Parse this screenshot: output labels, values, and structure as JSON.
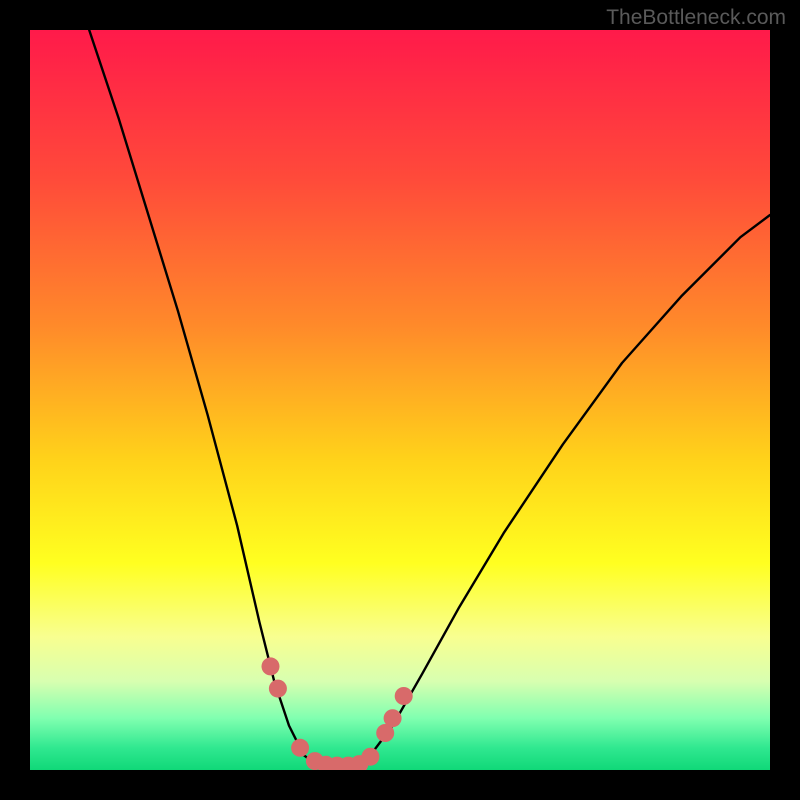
{
  "watermark": "TheBottleneck.com",
  "chart_data": {
    "type": "line",
    "title": "",
    "xlabel": "",
    "ylabel": "",
    "x_range": [
      0,
      100
    ],
    "y_range": [
      0,
      100
    ],
    "curve_left": [
      {
        "x": 8,
        "y": 100
      },
      {
        "x": 12,
        "y": 88
      },
      {
        "x": 16,
        "y": 75
      },
      {
        "x": 20,
        "y": 62
      },
      {
        "x": 24,
        "y": 48
      },
      {
        "x": 28,
        "y": 33
      },
      {
        "x": 31,
        "y": 20
      },
      {
        "x": 33,
        "y": 12
      },
      {
        "x": 35,
        "y": 6
      },
      {
        "x": 37,
        "y": 2
      },
      {
        "x": 39,
        "y": 0.5
      }
    ],
    "curve_right": [
      {
        "x": 44,
        "y": 0.5
      },
      {
        "x": 46,
        "y": 2
      },
      {
        "x": 49,
        "y": 6
      },
      {
        "x": 53,
        "y": 13
      },
      {
        "x": 58,
        "y": 22
      },
      {
        "x": 64,
        "y": 32
      },
      {
        "x": 72,
        "y": 44
      },
      {
        "x": 80,
        "y": 55
      },
      {
        "x": 88,
        "y": 64
      },
      {
        "x": 96,
        "y": 72
      },
      {
        "x": 100,
        "y": 75
      }
    ],
    "markers_left": [
      {
        "x": 32.5,
        "y": 14
      },
      {
        "x": 33.5,
        "y": 11
      },
      {
        "x": 36.5,
        "y": 3
      },
      {
        "x": 38.5,
        "y": 1.2
      },
      {
        "x": 40,
        "y": 0.7
      },
      {
        "x": 41.5,
        "y": 0.6
      }
    ],
    "markers_right": [
      {
        "x": 43,
        "y": 0.6
      },
      {
        "x": 44.5,
        "y": 0.8
      },
      {
        "x": 46,
        "y": 1.8
      },
      {
        "x": 48,
        "y": 5
      },
      {
        "x": 49,
        "y": 7
      },
      {
        "x": 50.5,
        "y": 10
      }
    ],
    "gradient_stops": [
      {
        "offset": 0,
        "color": "#ff1a4a"
      },
      {
        "offset": 20,
        "color": "#ff4a3a"
      },
      {
        "offset": 40,
        "color": "#ff8a2a"
      },
      {
        "offset": 58,
        "color": "#ffd21a"
      },
      {
        "offset": 72,
        "color": "#ffff20"
      },
      {
        "offset": 82,
        "color": "#f8ff90"
      },
      {
        "offset": 88,
        "color": "#d8ffb0"
      },
      {
        "offset": 93,
        "color": "#80ffb0"
      },
      {
        "offset": 97,
        "color": "#30e890"
      },
      {
        "offset": 100,
        "color": "#10d878"
      }
    ],
    "marker_color": "#d86a6a",
    "curve_color": "#000000"
  }
}
